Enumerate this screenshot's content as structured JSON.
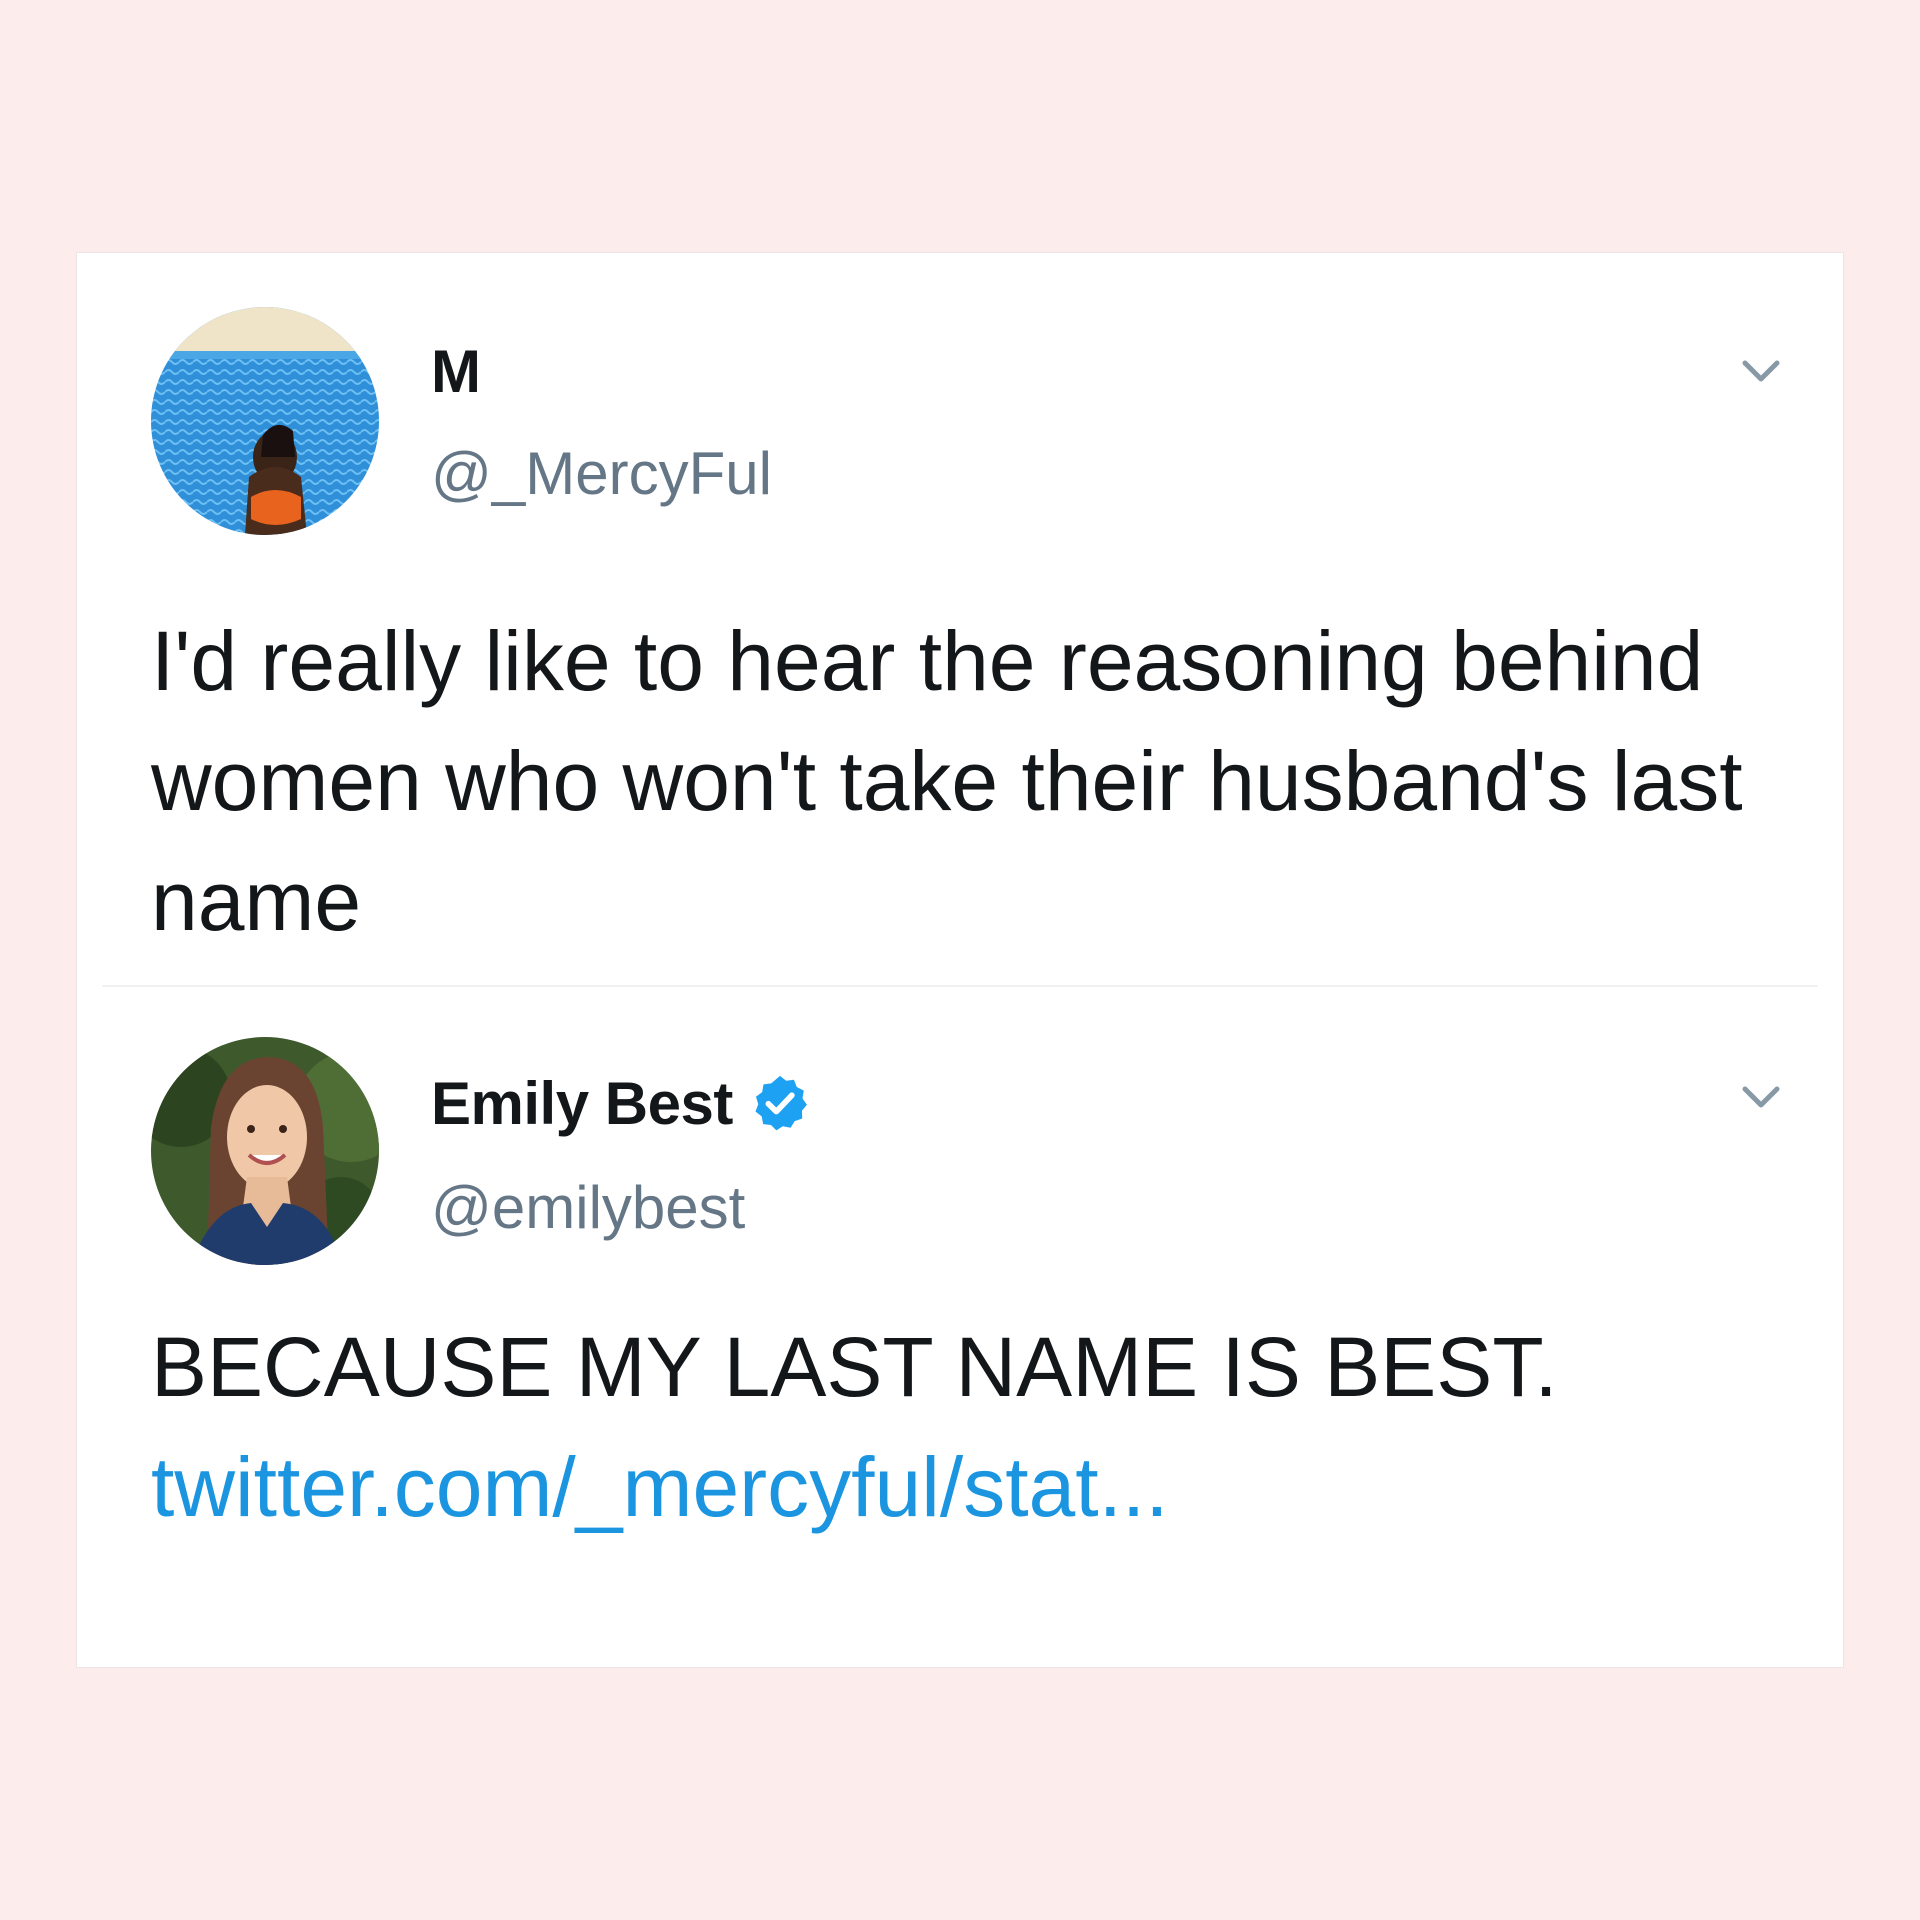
{
  "tweets": [
    {
      "display_name": "M",
      "handle": "@_MercyFul",
      "verified": false,
      "avatar": "avatar-photo-pool",
      "text": "I'd really like to hear the reasoning behind women who won't take their husband's last name",
      "menu_icon": "chevron-down-icon"
    },
    {
      "display_name": "Emily Best",
      "handle": "@emilybest",
      "verified": true,
      "avatar": "avatar-photo-portrait",
      "text": "BECAUSE MY LAST NAME IS BEST.",
      "link": "twitter.com/_mercyful/stat...",
      "menu_icon": "chevron-down-icon"
    }
  ],
  "colors": {
    "background": "#fcecec",
    "card": "#ffffff",
    "text": "#14171a",
    "handle": "#657786",
    "link": "#1b95e0",
    "verified": "#1da1f2"
  }
}
